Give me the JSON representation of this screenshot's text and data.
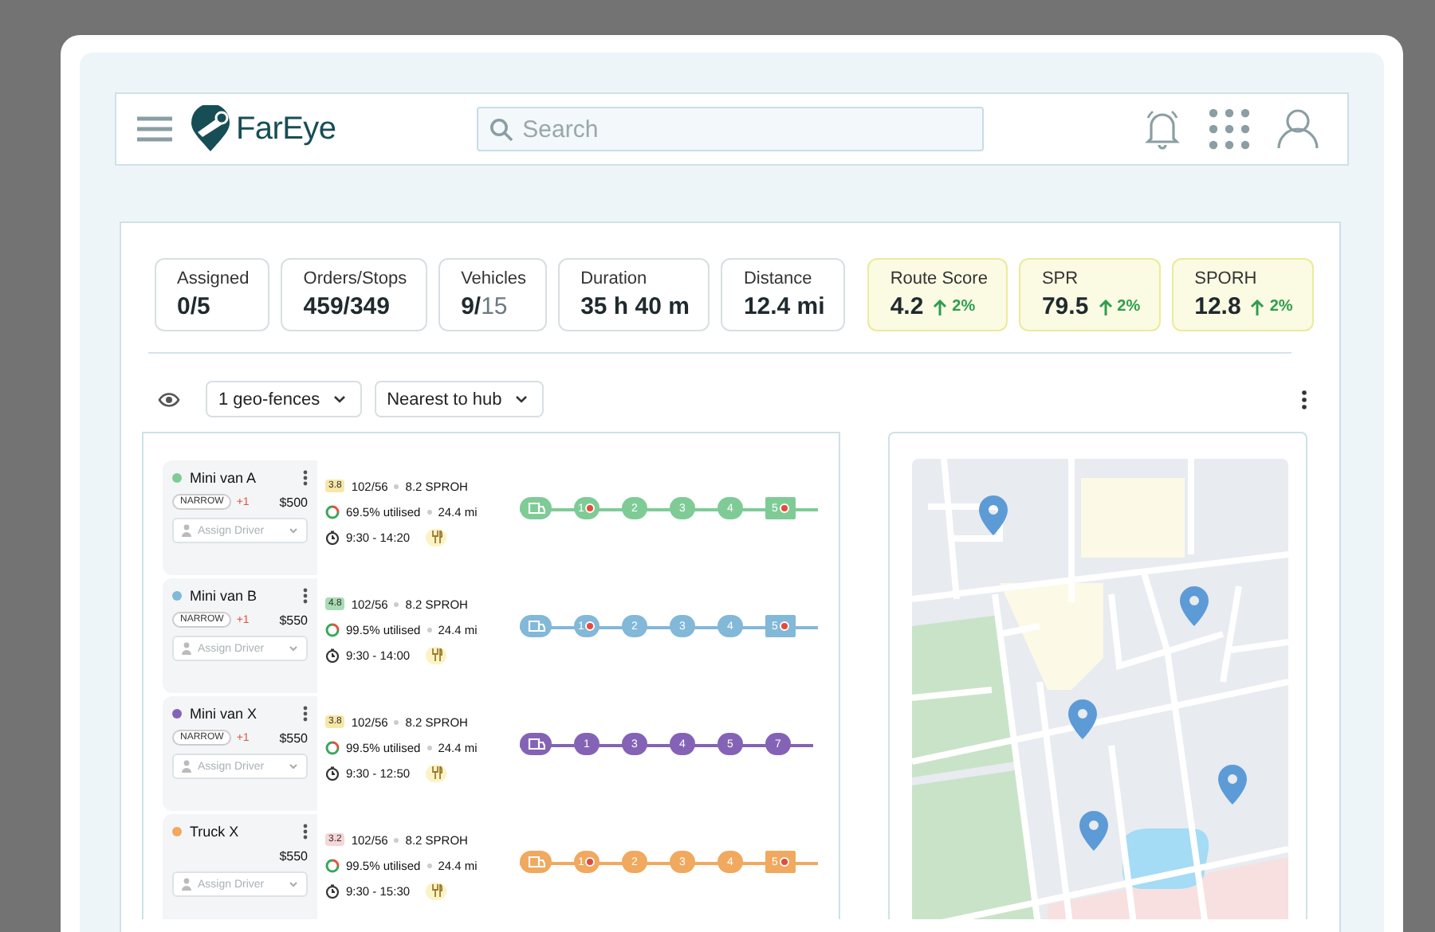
{
  "header": {
    "logo": "FarEye",
    "search": {
      "placeholder": "Search"
    }
  },
  "stats": [
    {
      "label": "Assigned",
      "value": "0/5",
      "highlight": false
    },
    {
      "label": "Orders/Stops",
      "value": "459/349",
      "highlight": false
    },
    {
      "label": "Vehicles",
      "value": "9/",
      "value_muted": "15",
      "highlight": false
    },
    {
      "label": "Duration",
      "value": "35 h 40 m",
      "highlight": false
    },
    {
      "label": "Distance",
      "value": "12.4 mi",
      "highlight": false
    },
    {
      "label": "Route Score",
      "value": "4.2",
      "trend": "2%",
      "highlight": true
    },
    {
      "label": "SPR",
      "value": "79.5",
      "trend": "2%",
      "highlight": true
    },
    {
      "label": "SPORH",
      "value": "12.8",
      "trend": "2%",
      "highlight": true
    }
  ],
  "filters": [
    {
      "label": "1 geo-fences"
    },
    {
      "label": "Nearest to hub"
    }
  ],
  "vehicles": [
    {
      "name": "Mini van A",
      "color": "#7fcb96",
      "tags": [
        "NARROW",
        "+1"
      ],
      "cost": "$500",
      "driver_placeholder": "Assign Driver",
      "score": {
        "value": "3.8",
        "color": "#f7e7a6"
      },
      "orders": "102/56",
      "sproh": "8.2 SPROH",
      "utilised": "69.5% utilised",
      "distance": "24.4 mi",
      "time": "9:30 - 14:20",
      "stops": [
        {
          "kind": "depot",
          "alert": false
        },
        {
          "kind": "stop",
          "label": "1",
          "alert": true
        },
        {
          "kind": "stop",
          "label": "2",
          "alert": false
        },
        {
          "kind": "stop",
          "label": "3",
          "alert": false
        },
        {
          "kind": "stop",
          "label": "4",
          "alert": false
        },
        {
          "kind": "end",
          "label": "5",
          "alert": true
        }
      ]
    },
    {
      "name": "Mini van B",
      "color": "#82b8d8",
      "tags": [
        "NARROW",
        "+1"
      ],
      "cost": "$550",
      "driver_placeholder": "Assign Driver",
      "score": {
        "value": "4.8",
        "color": "#a8dcb5"
      },
      "orders": "102/56",
      "sproh": "8.2 SPROH",
      "utilised": "99.5% utilised",
      "distance": "24.4 mi",
      "time": "9:30 - 14:00",
      "stops": [
        {
          "kind": "depot",
          "alert": false
        },
        {
          "kind": "stop",
          "label": "1",
          "alert": true
        },
        {
          "kind": "stop",
          "label": "2",
          "alert": false
        },
        {
          "kind": "stop",
          "label": "3",
          "alert": false
        },
        {
          "kind": "stop",
          "label": "4",
          "alert": false
        },
        {
          "kind": "end",
          "label": "5",
          "alert": true
        }
      ]
    },
    {
      "name": "Mini van X",
      "color": "#8463b6",
      "tags": [
        "NARROW",
        "+1"
      ],
      "cost": "$550",
      "driver_placeholder": "Assign Driver",
      "score": {
        "value": "3.8",
        "color": "#f7e7a6"
      },
      "orders": "102/56",
      "sproh": "8.2 SPROH",
      "utilised": "99.5% utilised",
      "distance": "24.4 mi",
      "time": "9:30 - 12:50",
      "stops": [
        {
          "kind": "depot",
          "alert": false
        },
        {
          "kind": "stop",
          "label": "1",
          "alert": false
        },
        {
          "kind": "stop",
          "label": "3",
          "alert": false
        },
        {
          "kind": "stop",
          "label": "4",
          "alert": false
        },
        {
          "kind": "stop",
          "label": "5",
          "alert": false
        },
        {
          "kind": "stop",
          "label": "7",
          "alert": false
        }
      ]
    },
    {
      "name": "Truck X",
      "color": "#f0a95e",
      "cost": "$550",
      "driver_placeholder": "Assign Driver",
      "score": {
        "value": "3.2",
        "color": "#f7d6d6"
      },
      "orders": "102/56",
      "sproh": "8.2 SPROH",
      "utilised": "99.5% utilised",
      "distance": "24.4 mi",
      "time": "9:30 - 15:30",
      "stops": [
        {
          "kind": "depot",
          "alert": false
        },
        {
          "kind": "stop",
          "label": "1",
          "alert": true
        },
        {
          "kind": "stop",
          "label": "2",
          "alert": false
        },
        {
          "kind": "stop",
          "label": "3",
          "alert": false
        },
        {
          "kind": "stop",
          "label": "4",
          "alert": false
        },
        {
          "kind": "end",
          "label": "5",
          "alert": true
        }
      ]
    }
  ]
}
